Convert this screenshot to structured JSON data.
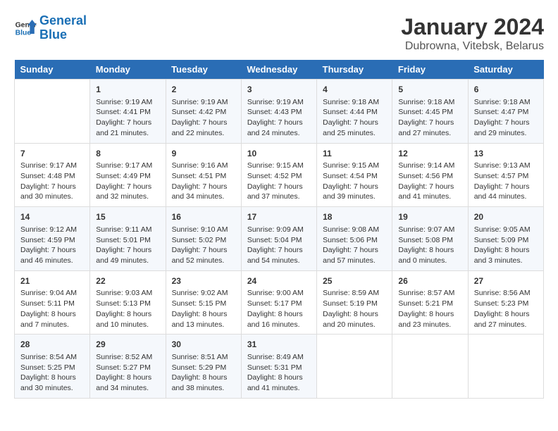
{
  "logo": {
    "text_general": "General",
    "text_blue": "Blue"
  },
  "header": {
    "title": "January 2024",
    "subtitle": "Dubrowna, Vitebsk, Belarus"
  },
  "days_of_week": [
    "Sunday",
    "Monday",
    "Tuesday",
    "Wednesday",
    "Thursday",
    "Friday",
    "Saturday"
  ],
  "weeks": [
    [
      {
        "day": "",
        "info": ""
      },
      {
        "day": "1",
        "info": "Sunrise: 9:19 AM\nSunset: 4:41 PM\nDaylight: 7 hours\nand 21 minutes."
      },
      {
        "day": "2",
        "info": "Sunrise: 9:19 AM\nSunset: 4:42 PM\nDaylight: 7 hours\nand 22 minutes."
      },
      {
        "day": "3",
        "info": "Sunrise: 9:19 AM\nSunset: 4:43 PM\nDaylight: 7 hours\nand 24 minutes."
      },
      {
        "day": "4",
        "info": "Sunrise: 9:18 AM\nSunset: 4:44 PM\nDaylight: 7 hours\nand 25 minutes."
      },
      {
        "day": "5",
        "info": "Sunrise: 9:18 AM\nSunset: 4:45 PM\nDaylight: 7 hours\nand 27 minutes."
      },
      {
        "day": "6",
        "info": "Sunrise: 9:18 AM\nSunset: 4:47 PM\nDaylight: 7 hours\nand 29 minutes."
      }
    ],
    [
      {
        "day": "7",
        "info": "Sunrise: 9:17 AM\nSunset: 4:48 PM\nDaylight: 7 hours\nand 30 minutes."
      },
      {
        "day": "8",
        "info": "Sunrise: 9:17 AM\nSunset: 4:49 PM\nDaylight: 7 hours\nand 32 minutes."
      },
      {
        "day": "9",
        "info": "Sunrise: 9:16 AM\nSunset: 4:51 PM\nDaylight: 7 hours\nand 34 minutes."
      },
      {
        "day": "10",
        "info": "Sunrise: 9:15 AM\nSunset: 4:52 PM\nDaylight: 7 hours\nand 37 minutes."
      },
      {
        "day": "11",
        "info": "Sunrise: 9:15 AM\nSunset: 4:54 PM\nDaylight: 7 hours\nand 39 minutes."
      },
      {
        "day": "12",
        "info": "Sunrise: 9:14 AM\nSunset: 4:56 PM\nDaylight: 7 hours\nand 41 minutes."
      },
      {
        "day": "13",
        "info": "Sunrise: 9:13 AM\nSunset: 4:57 PM\nDaylight: 7 hours\nand 44 minutes."
      }
    ],
    [
      {
        "day": "14",
        "info": "Sunrise: 9:12 AM\nSunset: 4:59 PM\nDaylight: 7 hours\nand 46 minutes."
      },
      {
        "day": "15",
        "info": "Sunrise: 9:11 AM\nSunset: 5:01 PM\nDaylight: 7 hours\nand 49 minutes."
      },
      {
        "day": "16",
        "info": "Sunrise: 9:10 AM\nSunset: 5:02 PM\nDaylight: 7 hours\nand 52 minutes."
      },
      {
        "day": "17",
        "info": "Sunrise: 9:09 AM\nSunset: 5:04 PM\nDaylight: 7 hours\nand 54 minutes."
      },
      {
        "day": "18",
        "info": "Sunrise: 9:08 AM\nSunset: 5:06 PM\nDaylight: 7 hours\nand 57 minutes."
      },
      {
        "day": "19",
        "info": "Sunrise: 9:07 AM\nSunset: 5:08 PM\nDaylight: 8 hours\nand 0 minutes."
      },
      {
        "day": "20",
        "info": "Sunrise: 9:05 AM\nSunset: 5:09 PM\nDaylight: 8 hours\nand 3 minutes."
      }
    ],
    [
      {
        "day": "21",
        "info": "Sunrise: 9:04 AM\nSunset: 5:11 PM\nDaylight: 8 hours\nand 7 minutes."
      },
      {
        "day": "22",
        "info": "Sunrise: 9:03 AM\nSunset: 5:13 PM\nDaylight: 8 hours\nand 10 minutes."
      },
      {
        "day": "23",
        "info": "Sunrise: 9:02 AM\nSunset: 5:15 PM\nDaylight: 8 hours\nand 13 minutes."
      },
      {
        "day": "24",
        "info": "Sunrise: 9:00 AM\nSunset: 5:17 PM\nDaylight: 8 hours\nand 16 minutes."
      },
      {
        "day": "25",
        "info": "Sunrise: 8:59 AM\nSunset: 5:19 PM\nDaylight: 8 hours\nand 20 minutes."
      },
      {
        "day": "26",
        "info": "Sunrise: 8:57 AM\nSunset: 5:21 PM\nDaylight: 8 hours\nand 23 minutes."
      },
      {
        "day": "27",
        "info": "Sunrise: 8:56 AM\nSunset: 5:23 PM\nDaylight: 8 hours\nand 27 minutes."
      }
    ],
    [
      {
        "day": "28",
        "info": "Sunrise: 8:54 AM\nSunset: 5:25 PM\nDaylight: 8 hours\nand 30 minutes."
      },
      {
        "day": "29",
        "info": "Sunrise: 8:52 AM\nSunset: 5:27 PM\nDaylight: 8 hours\nand 34 minutes."
      },
      {
        "day": "30",
        "info": "Sunrise: 8:51 AM\nSunset: 5:29 PM\nDaylight: 8 hours\nand 38 minutes."
      },
      {
        "day": "31",
        "info": "Sunrise: 8:49 AM\nSunset: 5:31 PM\nDaylight: 8 hours\nand 41 minutes."
      },
      {
        "day": "",
        "info": ""
      },
      {
        "day": "",
        "info": ""
      },
      {
        "day": "",
        "info": ""
      }
    ]
  ]
}
